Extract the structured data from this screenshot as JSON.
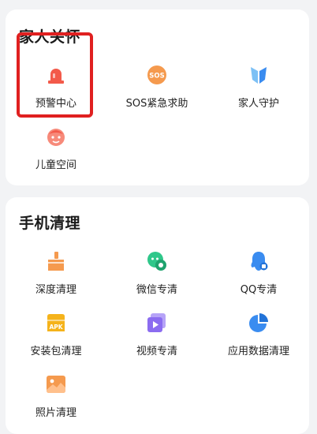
{
  "family_care": {
    "title": "家人关怀",
    "items": [
      {
        "label": "预警中心",
        "icon": "alarm-light-icon"
      },
      {
        "label": "SOS紧急求助",
        "icon": "sos-icon",
        "badge": "SOS"
      },
      {
        "label": "家人守护",
        "icon": "shield-icon"
      },
      {
        "label": "儿童空间",
        "icon": "child-face-icon"
      }
    ]
  },
  "phone_cleanup": {
    "title": "手机清理",
    "items": [
      {
        "label": "深度清理",
        "icon": "broom-icon"
      },
      {
        "label": "微信专清",
        "icon": "wechat-icon"
      },
      {
        "label": "QQ专清",
        "icon": "qq-icon"
      },
      {
        "label": "安装包清理",
        "icon": "apk-icon",
        "badge": "APK"
      },
      {
        "label": "视频专清",
        "icon": "video-icon"
      },
      {
        "label": "应用数据清理",
        "icon": "pie-chart-icon"
      },
      {
        "label": "照片清理",
        "icon": "photo-icon"
      }
    ]
  },
  "colors": {
    "red": "#f35a4a",
    "orange": "#f59a4e",
    "blue": "#3a8cf0",
    "green": "#2fc78a",
    "purple": "#8b6cf0",
    "yellow": "#f5b31b",
    "highlight": "#e02020"
  }
}
